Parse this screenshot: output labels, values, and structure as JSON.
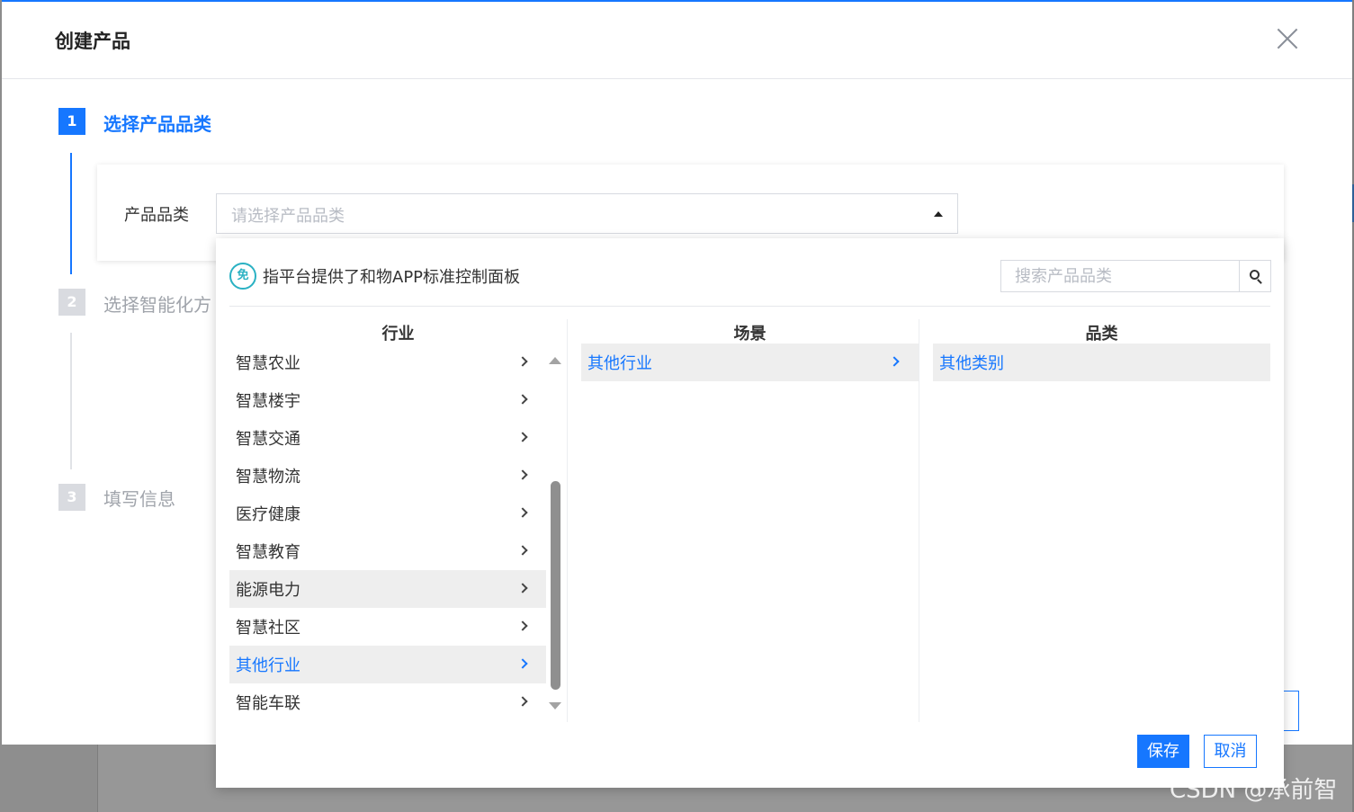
{
  "modal": {
    "title": "创建产品"
  },
  "steps": [
    {
      "num": "1",
      "label": "选择产品品类",
      "state": "active"
    },
    {
      "num": "2",
      "label": "选择智能化方",
      "state": "inactive"
    },
    {
      "num": "3",
      "label": "填写信息",
      "state": "inactive"
    }
  ],
  "form": {
    "category_label": "产品品类",
    "category_placeholder": "请选择产品品类"
  },
  "panel": {
    "badge": "免",
    "note": "指平台提供了和物APP标准控制面板",
    "search_placeholder": "搜索产品品类",
    "columns": {
      "industry": "行业",
      "scene": "场景",
      "category": "品类"
    },
    "industries": [
      "智慧农业",
      "智慧楼宇",
      "智慧交通",
      "智慧物流",
      "医疗健康",
      "智慧教育",
      "能源电力",
      "智慧社区",
      "其他行业",
      "智能车联"
    ],
    "hovered_industry": "能源电力",
    "selected_industry": "其他行业",
    "scenes": [
      "其他行业"
    ],
    "categories": [
      "其他类别"
    ],
    "save_label": "保存",
    "cancel_label": "取消"
  },
  "colors": {
    "primary": "#1677ff",
    "badge": "#2ab1c3",
    "hover_bg": "#eeeeee"
  },
  "watermark": "CSDN @承前智"
}
